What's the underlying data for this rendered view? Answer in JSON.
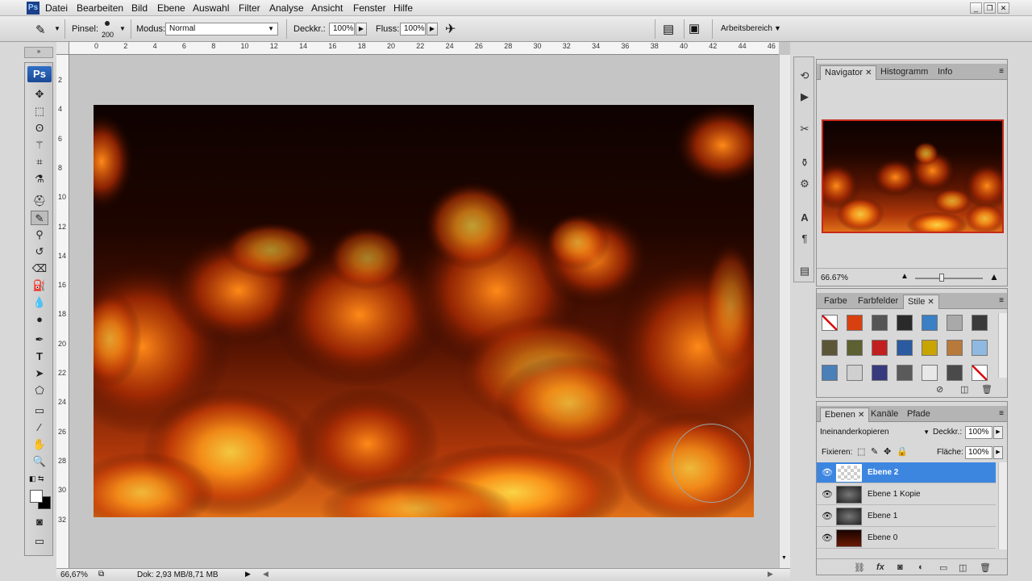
{
  "menubar": {
    "items": [
      "Datei",
      "Bearbeiten",
      "Bild",
      "Ebene",
      "Auswahl",
      "Filter",
      "Analyse",
      "Ansicht",
      "Fenster",
      "Hilfe"
    ]
  },
  "options": {
    "brush_label": "Pinsel:",
    "brush_size": "200",
    "mode_label": "Modus:",
    "mode_value": "Normal",
    "opacity_label": "Deckkr.:",
    "opacity_value": "100%",
    "flow_label": "Fluss:",
    "flow_value": "100%",
    "workspace_label": "Arbeitsbereich"
  },
  "toolbox": {
    "logo": "Ps"
  },
  "ruler": {
    "top": [
      "0",
      "2",
      "4",
      "6",
      "8",
      "10",
      "12",
      "14",
      "16",
      "18",
      "20",
      "22",
      "24",
      "26",
      "28",
      "30",
      "32",
      "34",
      "36",
      "38",
      "40",
      "42",
      "44",
      "46"
    ],
    "left": [
      "2",
      "4",
      "6",
      "8",
      "10",
      "12",
      "14",
      "16",
      "18",
      "20",
      "22",
      "24",
      "26",
      "28",
      "30",
      "32"
    ]
  },
  "status": {
    "zoom": "66,67%",
    "doc": "Dok: 2,93 MB/8,71 MB"
  },
  "navigator": {
    "tabs": [
      "Navigator",
      "Histogramm",
      "Info"
    ],
    "zoom": "66.67%"
  },
  "styles": {
    "tabs": [
      "Farbe",
      "Farbfelder",
      "Stile"
    ],
    "swatch_colors": [
      "#ffffff",
      "#d94010",
      "#555555",
      "#2a2a2a",
      "#3b7fc4",
      "#a9a9a9",
      "#3a3a3a",
      "#5c5638",
      "#5d6030",
      "#c22020",
      "#2a5aa0",
      "#c8a400",
      "#b87a3a",
      "#8fb9e0",
      "#4a7fb8",
      "#d0d0d0",
      "#383a7e",
      "#5a5a5a",
      "#e8e8e8",
      "#4a4a4a",
      "#ffffff"
    ]
  },
  "layers": {
    "tabs": [
      "Ebenen",
      "Kanäle",
      "Pfade"
    ],
    "blend_mode": "Ineinanderkopieren",
    "opacity_label": "Deckkr.:",
    "opacity_value": "100%",
    "lock_label": "Fixieren:",
    "fill_label": "Fläche:",
    "fill_value": "100%",
    "items": [
      {
        "name": "Ebene 2",
        "selected": true
      },
      {
        "name": "Ebene 1 Kopie",
        "selected": false
      },
      {
        "name": "Ebene 1",
        "selected": false
      },
      {
        "name": "Ebene 0",
        "selected": false
      }
    ]
  },
  "colors": {
    "accent": "#3d86e0",
    "flame_orange": "#ff7a10",
    "flame_yellow": "#ffd23a",
    "dark": "#120400"
  }
}
